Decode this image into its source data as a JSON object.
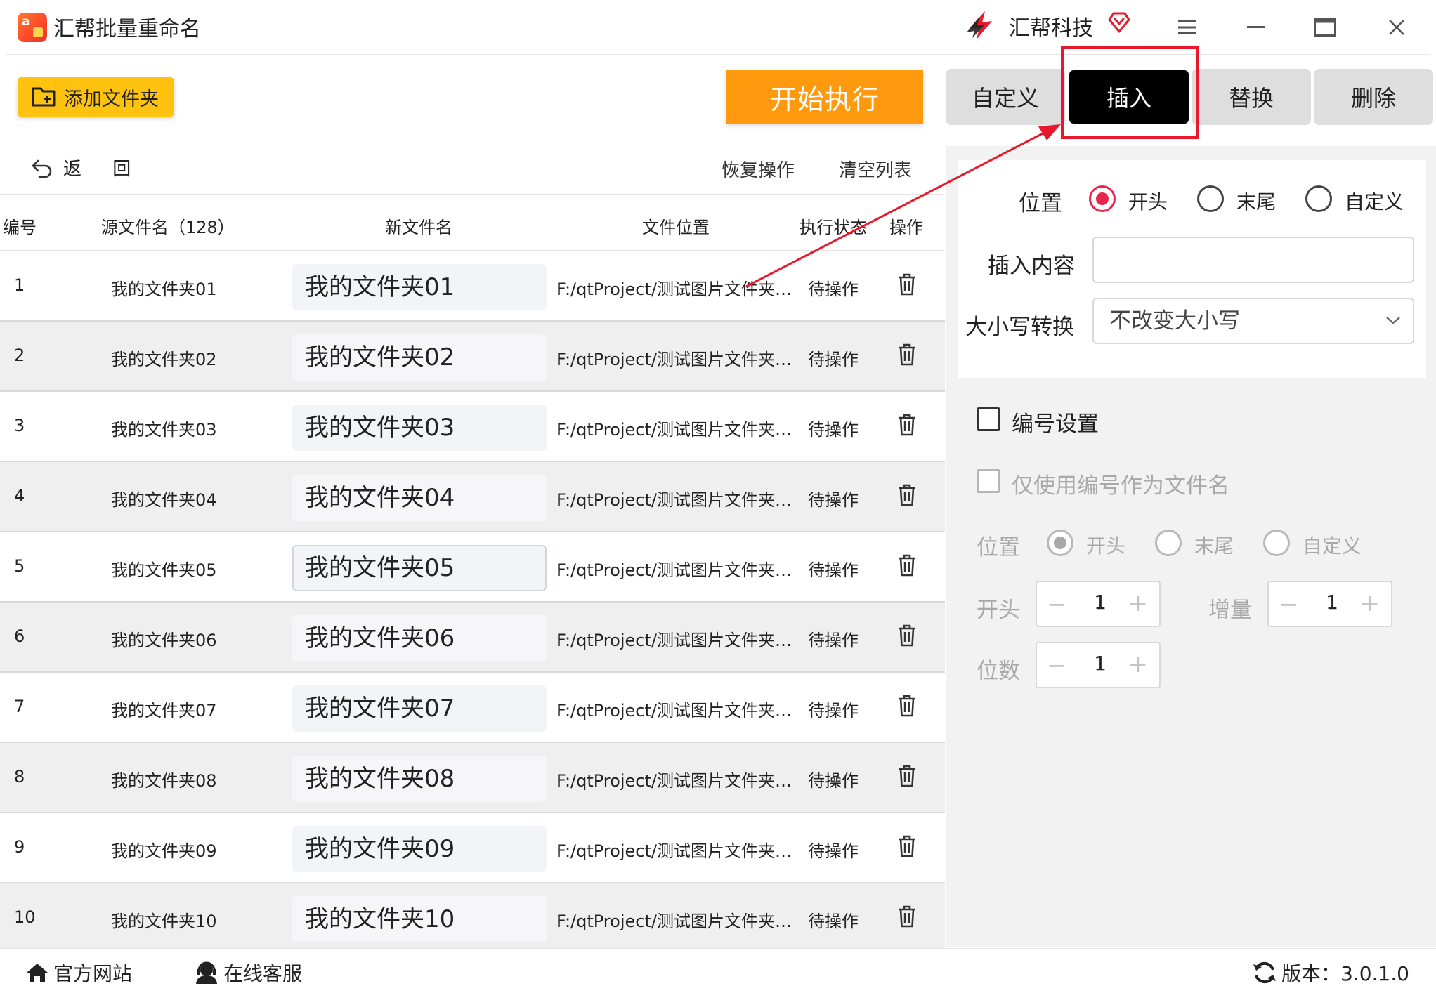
{
  "window": {
    "title": "汇帮批量重命名",
    "brand": "汇帮科技"
  },
  "toolbar": {
    "add_folder_label": "添加文件夹",
    "start_label": "开始执行",
    "back_label": "返 回",
    "restore_label": "恢复操作",
    "clear_label": "清空列表"
  },
  "tabs": [
    {
      "label": "自定义",
      "active": false
    },
    {
      "label": "插入",
      "active": true
    },
    {
      "label": "替换",
      "active": false
    },
    {
      "label": "删除",
      "active": false
    }
  ],
  "table": {
    "headers": {
      "num": "编号",
      "source": "源文件名（128）",
      "new_name": "新文件名",
      "location": "文件位置",
      "status": "执行状态",
      "op": "操作"
    },
    "rows": [
      {
        "num": "1",
        "source": "我的文件夹01",
        "new_name": "我的文件夹01",
        "location": "F:/qtProject/测试图片文件夹/...",
        "status": "待操作"
      },
      {
        "num": "2",
        "source": "我的文件夹02",
        "new_name": "我的文件夹02",
        "location": "F:/qtProject/测试图片文件夹/...",
        "status": "待操作"
      },
      {
        "num": "3",
        "source": "我的文件夹03",
        "new_name": "我的文件夹03",
        "location": "F:/qtProject/测试图片文件夹/...",
        "status": "待操作"
      },
      {
        "num": "4",
        "source": "我的文件夹04",
        "new_name": "我的文件夹04",
        "location": "F:/qtProject/测试图片文件夹/...",
        "status": "待操作"
      },
      {
        "num": "5",
        "source": "我的文件夹05",
        "new_name": "我的文件夹05",
        "location": "F:/qtProject/测试图片文件夹/...",
        "status": "待操作"
      },
      {
        "num": "6",
        "source": "我的文件夹06",
        "new_name": "我的文件夹06",
        "location": "F:/qtProject/测试图片文件夹/...",
        "status": "待操作"
      },
      {
        "num": "7",
        "source": "我的文件夹07",
        "new_name": "我的文件夹07",
        "location": "F:/qtProject/测试图片文件夹/...",
        "status": "待操作"
      },
      {
        "num": "8",
        "source": "我的文件夹08",
        "new_name": "我的文件夹08",
        "location": "F:/qtProject/测试图片文件夹/...",
        "status": "待操作"
      },
      {
        "num": "9",
        "source": "我的文件夹09",
        "new_name": "我的文件夹09",
        "location": "F:/qtProject/测试图片文件夹/...",
        "status": "待操作"
      },
      {
        "num": "10",
        "source": "我的文件夹10",
        "new_name": "我的文件夹10",
        "location": "F:/qtProject/测试图片文件夹/...",
        "status": "待操作"
      }
    ]
  },
  "insert_panel": {
    "position_label": "位置",
    "position_options": [
      "开头",
      "末尾",
      "自定义"
    ],
    "position_selected": "开头",
    "content_label": "插入内容",
    "content_value": "",
    "case_label": "大小写转换",
    "case_value": "不改变大小写"
  },
  "numbering": {
    "enable_label": "编号设置",
    "only_number_label": "仅使用编号作为文件名",
    "position_label": "位置",
    "position_options": [
      "开头",
      "末尾",
      "自定义"
    ],
    "position_selected": "开头",
    "start_label": "开头",
    "start_value": "1",
    "increment_label": "增量",
    "increment_value": "1",
    "digits_label": "位数",
    "digits_value": "1",
    "minus": "−",
    "plus": "+"
  },
  "footer": {
    "website_label": "官方网站",
    "support_label": "在线客服",
    "version_label": "版本：3.0.1.0"
  },
  "colors": {
    "accent_yellow": "#ffc20e",
    "start_orange": "#ff9a0f",
    "active_tab": "#000000",
    "radio_red": "#e8264b",
    "annotation_red": "#e8192c"
  },
  "icons": {
    "app": "rename-app-icon",
    "brand": "huibang-logo-icon",
    "vip": "vip-heart-icon",
    "menu": "hamburger-menu-icon",
    "minimize": "minimize-icon",
    "maximize": "maximize-icon",
    "close": "close-icon",
    "add_folder": "folder-plus-icon",
    "back": "undo-arrow-icon",
    "delete": "trash-icon",
    "dropdown": "chevron-down-icon",
    "home": "home-icon",
    "support": "headset-icon",
    "refresh": "refresh-icon"
  }
}
